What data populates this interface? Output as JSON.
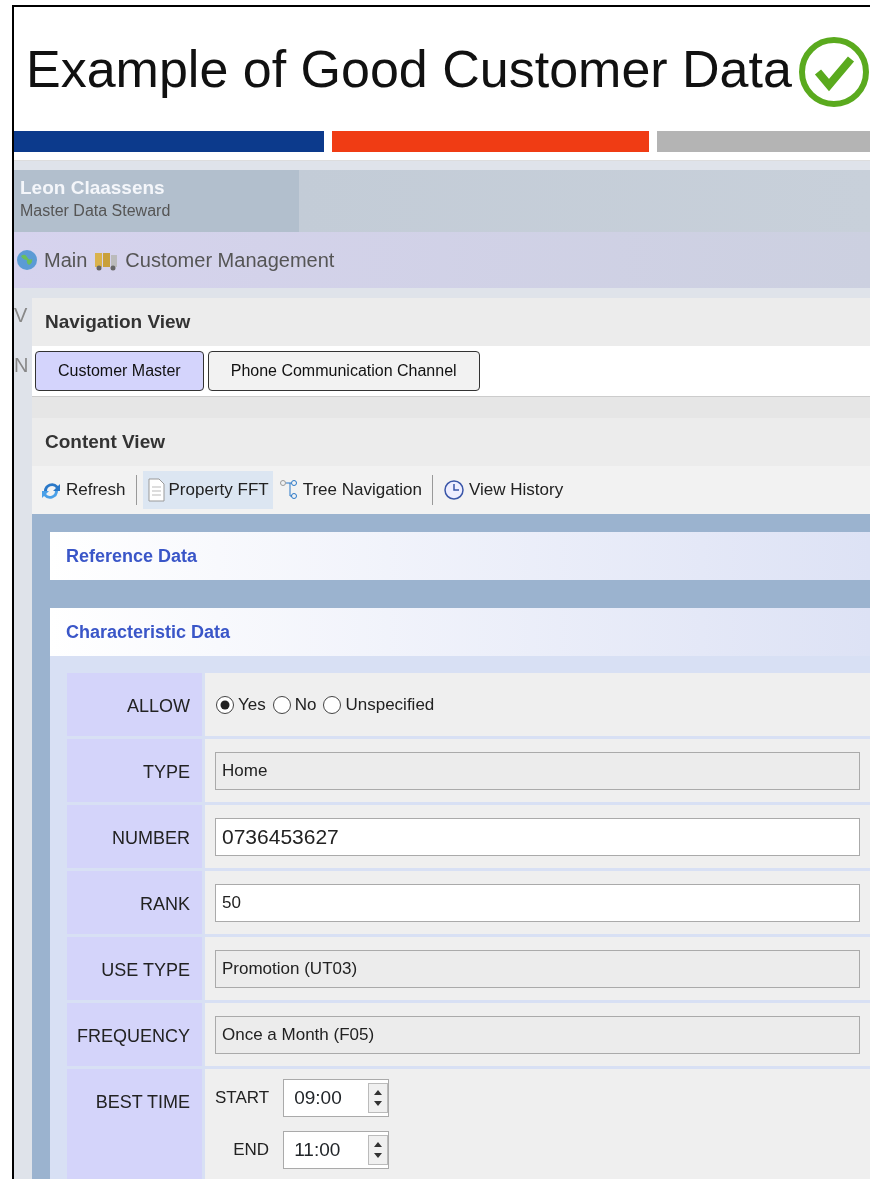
{
  "slide": {
    "title": "Example of Good Customer Data",
    "bars": [
      {
        "color": "#0c3a8c"
      },
      {
        "color": "#f03c14"
      },
      {
        "color": "#b4b4b4"
      }
    ]
  },
  "user": {
    "name": "Leon Claassens",
    "role": "Master Data Steward"
  },
  "breadcrumb": [
    {
      "label": "Main"
    },
    {
      "label": "Customer Management"
    }
  ],
  "behind_letters": [
    "V",
    "N"
  ],
  "navigation_view": {
    "title": "Navigation View",
    "tabs": [
      {
        "label": "Customer Master",
        "selected": true
      },
      {
        "label": "Phone Communication Channel",
        "selected": false
      }
    ]
  },
  "content_view": {
    "title": "Content View",
    "toolbar": [
      {
        "label": "Refresh",
        "selected": false,
        "separator_after": true
      },
      {
        "label": "Property FFT",
        "selected": true,
        "separator_after": false
      },
      {
        "label": "Tree Navigation",
        "selected": false,
        "separator_after": true
      },
      {
        "label": "View History",
        "selected": false,
        "separator_after": false
      }
    ]
  },
  "sections": [
    {
      "title": "Reference Data"
    },
    {
      "title": "Characteristic Data"
    }
  ],
  "form": [
    {
      "kind": "radio",
      "label": "ALLOW",
      "options": [
        {
          "label": "Yes",
          "selected": true
        },
        {
          "label": "No",
          "selected": false
        },
        {
          "label": "Unspecified",
          "selected": false
        }
      ]
    },
    {
      "kind": "select",
      "label": "TYPE",
      "value": "Home"
    },
    {
      "kind": "input",
      "label": "NUMBER",
      "value": "0736453627"
    },
    {
      "kind": "input",
      "label": "RANK",
      "value": "50"
    },
    {
      "kind": "select",
      "label": "USE TYPE",
      "value": "Promotion (UT03)"
    },
    {
      "kind": "select",
      "label": "FREQUENCY",
      "value": "Once a Month (F05)"
    },
    {
      "kind": "time",
      "label": "BEST TIME",
      "times": [
        {
          "label": "START",
          "value": "09:00"
        },
        {
          "label": "END",
          "value": "11:00"
        }
      ]
    }
  ]
}
